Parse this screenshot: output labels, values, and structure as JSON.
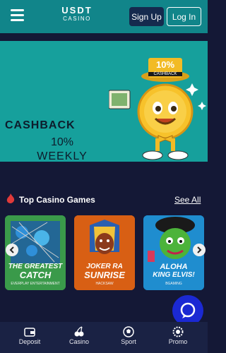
{
  "header": {
    "menu_icon": "hamburger-icon",
    "logo": {
      "line1": "USDT",
      "line2": "CASINO"
    },
    "signup_label": "Sign Up",
    "login_label": "Log In",
    "bg_color": "#11858a"
  },
  "banner": {
    "title": "CASHBACK",
    "line2": "10%",
    "line3": "WEEKLY",
    "badge_value": "10%",
    "badge_label": "CASHBACK",
    "bg_color": "#16a09c"
  },
  "top_games": {
    "icon": "fire-icon",
    "title": "Top Casino Games",
    "see_all_label": "See All",
    "games": [
      {
        "title_line1": "THE GREATEST",
        "title_line2": "CATCH",
        "vendor": "EVERPLAY ENTERTAINMENT"
      },
      {
        "title_line1": "JOKER RA",
        "title_line2": "SUNRISE",
        "vendor": "HACKSAW"
      },
      {
        "title_line1": "ALOHA",
        "title_line2": "KING ELVIS!",
        "vendor": "BGAMING"
      }
    ],
    "prev_icon": "chevron-left-icon",
    "next_icon": "chevron-right-icon"
  },
  "chat": {
    "icon": "chat-bubble-icon"
  },
  "bottom_nav": {
    "items": [
      {
        "label": "Deposit",
        "icon": "wallet-icon"
      },
      {
        "label": "Casino",
        "icon": "cherries-icon"
      },
      {
        "label": "Sport",
        "icon": "soccer-ball-icon"
      },
      {
        "label": "Promo",
        "icon": "gear-badge-icon"
      }
    ]
  }
}
